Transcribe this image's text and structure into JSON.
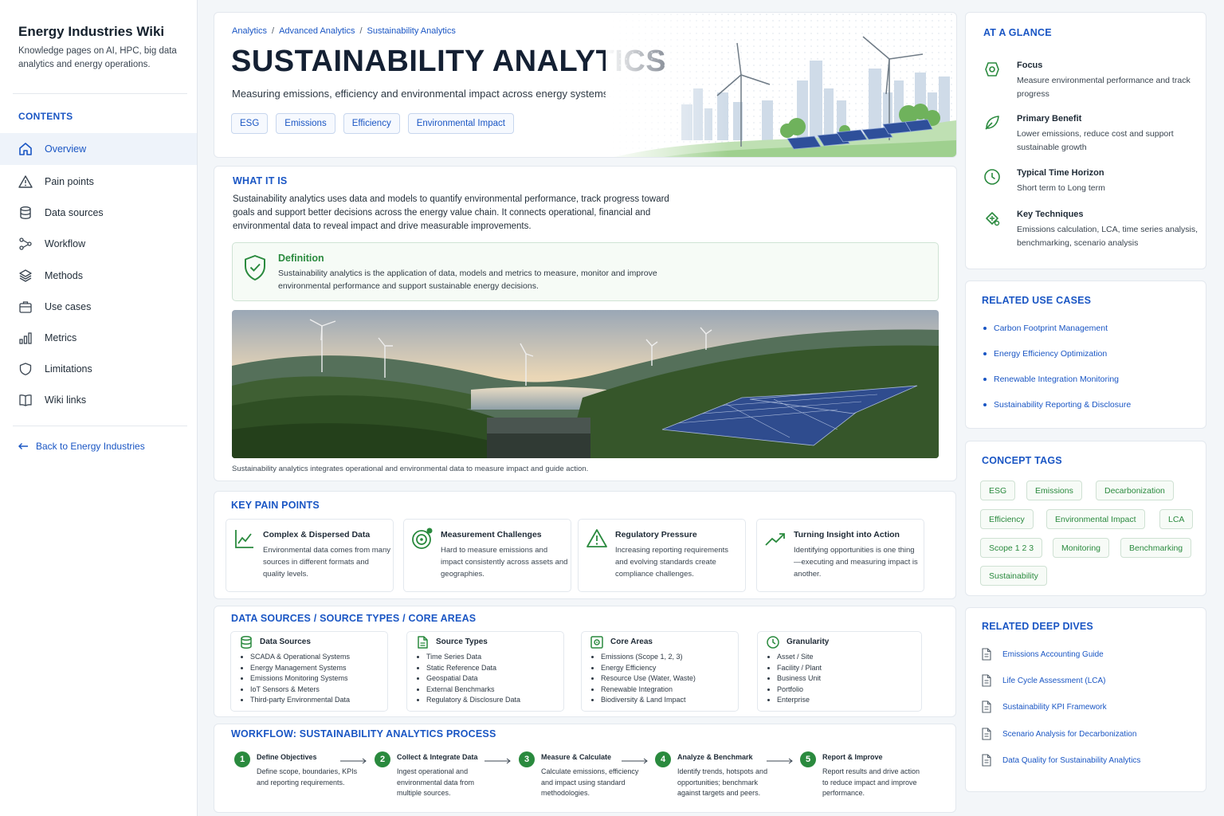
{
  "sidebar": {
    "title": "Energy Industries Wiki",
    "tagline": "Knowledge pages on AI, HPC, big data analytics and energy operations.",
    "contents_title": "CONTENTS",
    "items": [
      {
        "label": "Overview",
        "icon": "home-icon"
      },
      {
        "label": "Pain points",
        "icon": "warning-icon"
      },
      {
        "label": "Data sources",
        "icon": "database-icon"
      },
      {
        "label": "Workflow",
        "icon": "workflow-icon"
      },
      {
        "label": "Methods",
        "icon": "layers-icon"
      },
      {
        "label": "Use cases",
        "icon": "briefcase-icon"
      },
      {
        "label": "Metrics",
        "icon": "bar-chart-icon"
      },
      {
        "label": "Limitations",
        "icon": "shield-icon"
      },
      {
        "label": "Wiki links",
        "icon": "book-icon"
      }
    ],
    "back_link": "Back to Energy Industries"
  },
  "hero": {
    "breadcrumbs": [
      "Analytics",
      "Advanced Analytics",
      "Sustainability Analytics"
    ],
    "title": "SUSTAINABILITY ANALYTICS",
    "subtitle": "Measuring emissions, efficiency and environmental impact across energy systems.",
    "tags": [
      "ESG",
      "Emissions",
      "Efficiency",
      "Environmental Impact"
    ]
  },
  "what_it_is": {
    "title": "WHAT IT IS",
    "paragraph": "Sustainability analytics uses data and models to quantify environmental performance, track progress toward goals and support better decisions across the energy value chain. It connects operational, financial and environmental data to reveal impact and drive measurable improvements.",
    "definition_title": "Definition",
    "definition_text": "Sustainability analytics is the application of data, models and metrics to measure, monitor and improve environmental performance and support sustainable energy decisions.",
    "caption": "Sustainability analytics integrates operational and environmental data to measure impact and guide action."
  },
  "pain_points": {
    "title": "KEY PAIN POINTS",
    "items": [
      {
        "title": "Complex & Dispersed Data",
        "text": "Environmental data comes from many sources in different formats and quality levels."
      },
      {
        "title": "Measurement Challenges",
        "text": "Hard to measure emissions and impact consistently across assets and geographies."
      },
      {
        "title": "Regulatory Pressure",
        "text": "Increasing reporting requirements and evolving standards create compliance challenges."
      },
      {
        "title": "Turning Insight into Action",
        "text": "Identifying opportunities is one thing—executing and measuring impact is another."
      }
    ]
  },
  "sources": {
    "title": "DATA SOURCES / SOURCE TYPES / CORE AREAS",
    "cards": [
      {
        "title": "Data Sources",
        "items": [
          "SCADA & Operational Systems",
          "Energy Management Systems",
          "Emissions Monitoring Systems",
          "IoT Sensors & Meters",
          "Third-party Environmental Data"
        ]
      },
      {
        "title": "Source Types",
        "items": [
          "Time Series Data",
          "Static Reference Data",
          "Geospatial Data",
          "External Benchmarks",
          "Regulatory & Disclosure Data"
        ]
      },
      {
        "title": "Core Areas",
        "items": [
          "Emissions (Scope 1, 2, 3)",
          "Energy Efficiency",
          "Resource Use (Water, Waste)",
          "Renewable Integration",
          "Biodiversity & Land Impact"
        ]
      },
      {
        "title": "Granularity",
        "items": [
          "Asset / Site",
          "Facility / Plant",
          "Business Unit",
          "Portfolio",
          "Enterprise"
        ]
      }
    ]
  },
  "workflow": {
    "title": "WORKFLOW: SUSTAINABILITY ANALYTICS PROCESS",
    "steps": [
      {
        "num": "1",
        "title": "Define Objectives",
        "text": "Define scope, boundaries, KPIs and reporting requirements."
      },
      {
        "num": "2",
        "title": "Collect & Integrate Data",
        "text": "Ingest operational and environmental data from multiple sources."
      },
      {
        "num": "3",
        "title": "Measure & Calculate",
        "text": "Calculate emissions, efficiency and impact using standard methodologies."
      },
      {
        "num": "4",
        "title": "Analyze & Benchmark",
        "text": "Identify trends, hotspots and opportunities; benchmark against targets and peers."
      },
      {
        "num": "5",
        "title": "Report & Improve",
        "text": "Report results and drive action to reduce impact and improve performance."
      }
    ]
  },
  "at_a_glance": {
    "title": "AT A GLANCE",
    "items": [
      {
        "title": "Focus",
        "text": "Measure environmental performance and track progress"
      },
      {
        "title": "Primary Benefit",
        "text": "Lower emissions, reduce cost and support sustainable growth"
      },
      {
        "title": "Typical Time Horizon",
        "text": "Short term to Long term"
      },
      {
        "title": "Key Techniques",
        "text": "Emissions calculation, LCA, time series analysis, benchmarking, scenario analysis"
      }
    ]
  },
  "related_use_cases": {
    "title": "RELATED USE CASES",
    "items": [
      "Carbon Footprint Management",
      "Energy Efficiency Optimization",
      "Renewable Integration Monitoring",
      "Sustainability Reporting & Disclosure"
    ]
  },
  "concept_tags": {
    "title": "CONCEPT TAGS",
    "items": [
      "ESG",
      "Emissions",
      "Decarbonization",
      "Efficiency",
      "Environmental Impact",
      "LCA",
      "Scope 1 2 3",
      "Monitoring",
      "Benchmarking",
      "Sustainability"
    ]
  },
  "deep_dives": {
    "title": "RELATED DEEP DIVES",
    "items": [
      "Emissions Accounting Guide",
      "Life Cycle Assessment (LCA)",
      "Sustainability KPI Framework",
      "Scenario Analysis for Decarbonization",
      "Data Quality for Sustainability Analytics"
    ]
  },
  "colors": {
    "accent_blue": "#1a56c4",
    "accent_green": "#2a8a3e"
  }
}
